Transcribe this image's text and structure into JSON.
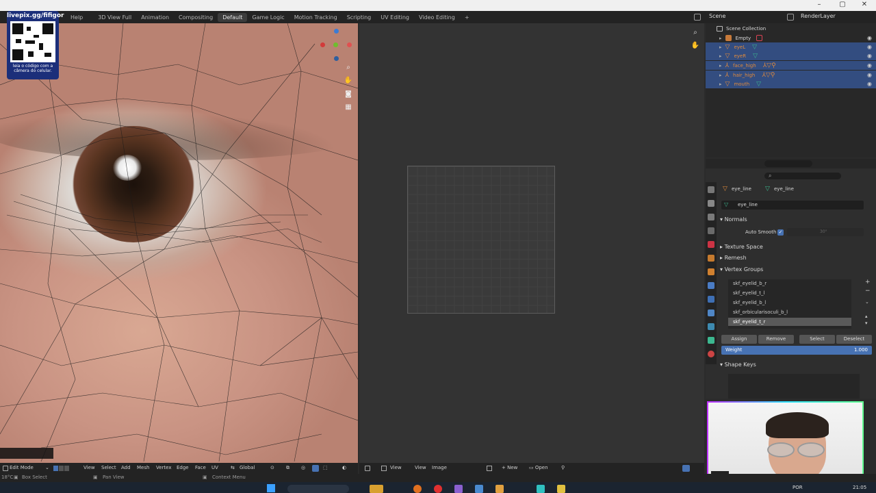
{
  "workspace_tabs": [
    "Help",
    "3D View Full",
    "Animation",
    "Compositing",
    "Default",
    "Game Logic",
    "Motion Tracking",
    "Scripting",
    "UV Editing",
    "Video Editing",
    "+"
  ],
  "active_tab": "Default",
  "scene": {
    "scene_label": "Scene",
    "render_layer": "RenderLayer"
  },
  "qr_overlay": {
    "title": "livepix.gg/fifigor",
    "caption_1": "leia o código com a",
    "caption_2": "câmera do celular."
  },
  "outliner": {
    "title": "Scene Collection",
    "items": [
      {
        "label": "Empty",
        "selected": false
      },
      {
        "label": "eyeL",
        "selected": true
      },
      {
        "label": "eyeR",
        "selected": true
      },
      {
        "label": "face_high",
        "selected": true
      },
      {
        "label": "hair_high",
        "selected": true
      },
      {
        "label": "mouth",
        "selected": true
      }
    ]
  },
  "properties": {
    "breadcrumb_object": "eye_line",
    "breadcrumb_data": "eye_line",
    "mesh_name": "eye_line",
    "sections": {
      "normals": "Normals",
      "auto_smooth": "Auto Smooth",
      "auto_smooth_angle": "30°",
      "texture_space": "Texture Space",
      "remesh": "Remesh",
      "vertex_groups": "Vertex Groups",
      "shape_keys": "Shape Keys"
    },
    "vertex_groups": [
      "skf_eyelid_b_r",
      "skf_eyelid_t_l",
      "skf_eyelid_b_l",
      "skf_orbicularisoculi_b_l",
      "skf_eyelid_t_r"
    ],
    "active_group_index": 4,
    "buttons": {
      "assign": "Assign",
      "remove": "Remove",
      "select": "Select",
      "deselect": "Deselect"
    },
    "weight_label": "Weight",
    "weight_value": "1.000"
  },
  "header_3d": {
    "mode": "Edit Mode",
    "menus": [
      "View",
      "Select",
      "Add",
      "Mesh",
      "Vertex",
      "Edge",
      "Face",
      "UV"
    ],
    "orientation": "Global"
  },
  "header_image": {
    "menus": [
      "View",
      "View",
      "Image"
    ],
    "new": "New",
    "open": "Open"
  },
  "status_bar": {
    "left": "Box Select",
    "middle": "Pan View",
    "right": "Context Menu",
    "corner_left": "18°C"
  },
  "taskbar": {
    "lang": "POR",
    "time": "21:05"
  },
  "colors": {
    "accent": "#4772b3",
    "selection": "#334d80",
    "object_orange": "#e08a3c",
    "mesh_green": "#3cb890"
  }
}
